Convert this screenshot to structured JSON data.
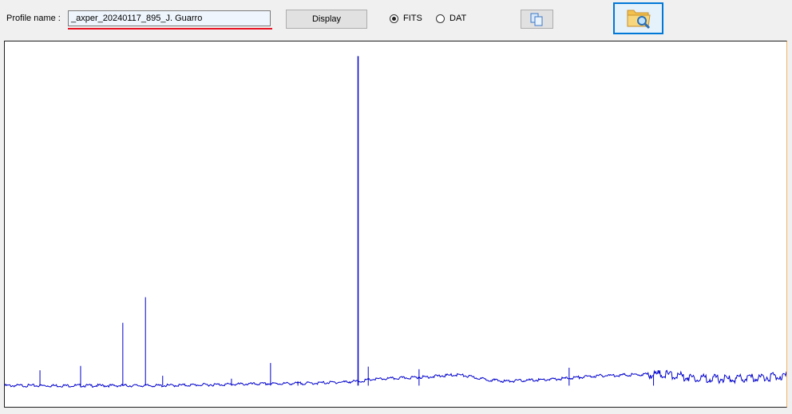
{
  "toolbar": {
    "profile_label": "Profile name :",
    "profile_value": "_axper_20240117_895_J. Guarro",
    "display_label": "Display",
    "format_options": [
      {
        "label": "FITS",
        "selected": true
      },
      {
        "label": "DAT",
        "selected": false
      }
    ]
  },
  "icons": {
    "copy": "copy-icon",
    "browse": "folder-search-icon"
  },
  "colors": {
    "accent": "#0078d7",
    "underline": "#e81123",
    "spectrum": "#0000cc"
  },
  "chart_data": {
    "type": "line",
    "title": "",
    "xlabel": "",
    "ylabel": "",
    "xlim": [
      0,
      1000
    ],
    "ylim": [
      0,
      1
    ],
    "baseline": [
      [
        0,
        0.058
      ],
      [
        100,
        0.058
      ],
      [
        200,
        0.058
      ],
      [
        300,
        0.062
      ],
      [
        400,
        0.065
      ],
      [
        455,
        0.07
      ],
      [
        470,
        0.075
      ],
      [
        520,
        0.08
      ],
      [
        540,
        0.082
      ],
      [
        580,
        0.088
      ],
      [
        615,
        0.075
      ],
      [
        640,
        0.07
      ],
      [
        700,
        0.075
      ],
      [
        760,
        0.085
      ],
      [
        840,
        0.09
      ],
      [
        880,
        0.08
      ],
      [
        930,
        0.075
      ],
      [
        1000,
        0.085
      ]
    ],
    "peaks": [
      {
        "x": 45,
        "y": 0.1
      },
      {
        "x": 97,
        "y": 0.112
      },
      {
        "x": 151,
        "y": 0.23
      },
      {
        "x": 180,
        "y": 0.3
      },
      {
        "x": 202,
        "y": 0.085
      },
      {
        "x": 290,
        "y": 0.077
      },
      {
        "x": 340,
        "y": 0.12
      },
      {
        "x": 375,
        "y": 0.07
      },
      {
        "x": 452,
        "y": 0.96
      },
      {
        "x": 465,
        "y": 0.11
      },
      {
        "x": 530,
        "y": 0.103
      },
      {
        "x": 722,
        "y": 0.107
      },
      {
        "x": 830,
        "y": 0.085
      }
    ]
  }
}
